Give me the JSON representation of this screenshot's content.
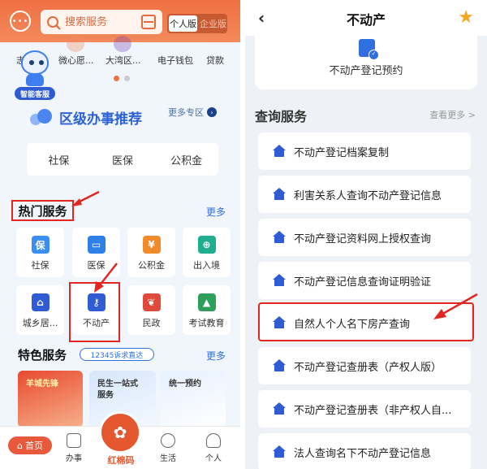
{
  "left": {
    "header": {
      "search_placeholder": "搜索服务",
      "mode_personal": "个人版",
      "mode_enterprise": "企业版"
    },
    "quick_items": [
      "志",
      "微心愿...",
      "大湾区...",
      "电子钱包",
      "贷款"
    ],
    "assistant_badge": "智能客服",
    "district": {
      "title": "区级办事推荐",
      "more": "更多专区",
      "tabs": [
        "社保",
        "医保",
        "公积金"
      ]
    },
    "hot_services": {
      "title": "热门服务",
      "more": "更多",
      "items": [
        {
          "label": "社保",
          "icon": "shield-icon",
          "color": "#3a8ef0"
        },
        {
          "label": "医保",
          "icon": "card-icon",
          "color": "#2f7fe8"
        },
        {
          "label": "公积金",
          "icon": "house-coin-icon",
          "color": "#f08a2a"
        },
        {
          "label": "出入境",
          "icon": "globe-icon",
          "color": "#1fae8e"
        },
        {
          "label": "城乡居...",
          "icon": "house-icon",
          "color": "#2f5bd3"
        },
        {
          "label": "不动产",
          "icon": "house-key-icon",
          "color": "#2f5bd3"
        },
        {
          "label": "民政",
          "icon": "hands-icon",
          "color": "#e04a3a"
        },
        {
          "label": "考试教育",
          "icon": "grad-cap-icon",
          "color": "#2e9f5a"
        }
      ]
    },
    "featured": {
      "title": "特色服务",
      "hotline": "12345诉求直达",
      "more": "更多",
      "cards": [
        "羊城先锋",
        "民生一站式\n服务",
        "统一预约"
      ]
    },
    "tabbar": {
      "home": "首页",
      "work": "办事",
      "center": "红棉码",
      "life": "生活",
      "me": "个人"
    }
  },
  "right": {
    "title": "不动产",
    "booking_label": "不动产登记预约",
    "query_title": "查询服务",
    "query_more": "查看更多 >",
    "items": [
      "不动产登记档案复制",
      "利害关系人查询不动产登记信息",
      "不动产登记资料网上授权查询",
      "不动产登记信息查询证明验证",
      "自然人个人名下房产查询",
      "不动产登记查册表（产权人版）",
      "不动产登记查册表（非产权人自...",
      "法人查询名下不动产登记信息"
    ]
  }
}
